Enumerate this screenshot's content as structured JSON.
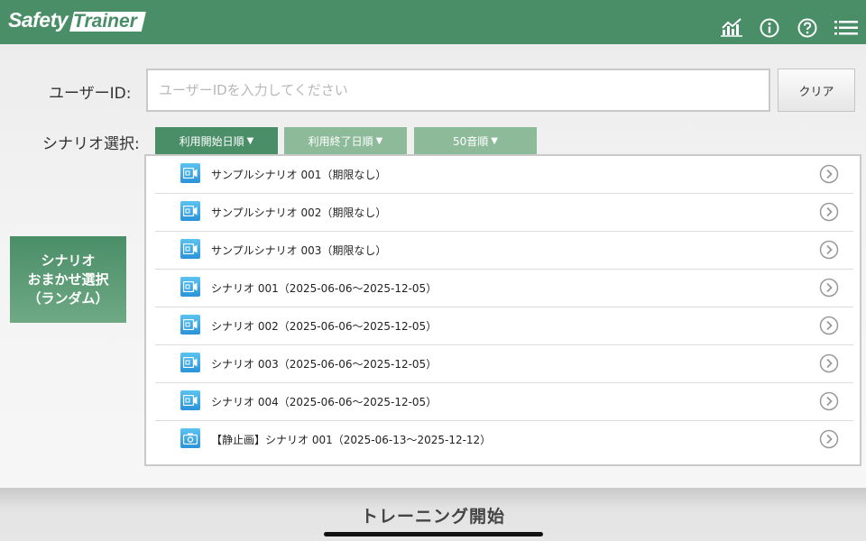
{
  "header": {
    "logo_part1": "Safety",
    "logo_part2": "Trainer",
    "icons": [
      "chart-icon",
      "info-icon",
      "help-icon",
      "menu-icon"
    ]
  },
  "user_id": {
    "label": "ユーザーID:",
    "placeholder": "ユーザーIDを入力してください",
    "value": "",
    "clear_label": "クリア"
  },
  "scenario_select": {
    "label": "シナリオ選択:",
    "sort_tabs": [
      {
        "label": "利用開始日順",
        "active": true
      },
      {
        "label": "利用終了日順",
        "active": false
      },
      {
        "label": "50音順",
        "active": false
      }
    ]
  },
  "random_button": {
    "label": "シナリオ\nおまかせ選択\n（ランダム）"
  },
  "scenarios": [
    {
      "title": "サンプルシナリオ 001（期限なし）",
      "icon": "video-camera-icon"
    },
    {
      "title": "サンプルシナリオ 002（期限なし）",
      "icon": "video-camera-icon"
    },
    {
      "title": "サンプルシナリオ 003（期限なし）",
      "icon": "video-camera-icon"
    },
    {
      "title": "シナリオ 001（2025-06-06～2025-12-05）",
      "icon": "video-camera-icon"
    },
    {
      "title": "シナリオ 002（2025-06-06～2025-12-05）",
      "icon": "video-camera-icon"
    },
    {
      "title": "シナリオ 003（2025-06-06～2025-12-05）",
      "icon": "video-camera-icon"
    },
    {
      "title": "シナリオ 004（2025-06-06～2025-12-05）",
      "icon": "video-camera-icon"
    },
    {
      "title": "【静止画】シナリオ 001（2025-06-13～2025-12-12）",
      "icon": "photo-camera-icon"
    }
  ],
  "start_button": {
    "label": "トレーニング開始"
  },
  "colors": {
    "brand_green": "#4a8e68",
    "tab_inactive": "#8dbb9a",
    "icon_blue": "#2a93d8"
  }
}
